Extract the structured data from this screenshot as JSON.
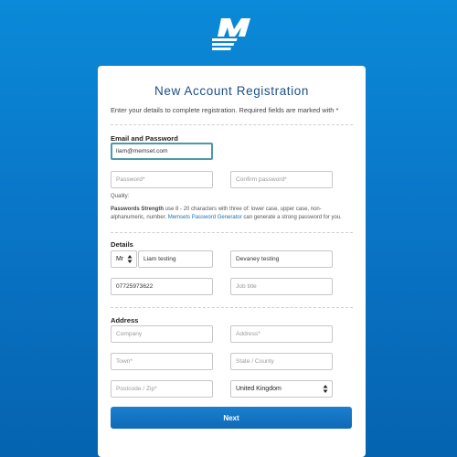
{
  "brand": {
    "logo_icon": "mythic-beasts-m-logo-icon",
    "accent": "#0a7fd4"
  },
  "form": {
    "title": "New Account Registration",
    "intro": "Enter your details to complete registration. Required fields are marked with *",
    "sections": {
      "email_password": "Email and Password",
      "details": "Details",
      "address": "Address"
    },
    "email": {
      "value": "liam@memset.com",
      "placeholder": ""
    },
    "password": {
      "placeholder": "Password*"
    },
    "confirm_password": {
      "placeholder": "Confirm password*"
    },
    "quality_label": "Quality:",
    "password_strength": {
      "label": "Passwords Strength",
      "text_before": " use 8 - 20 characters with three of: lower case, upper case, non-alphanumeric, number. ",
      "link": "Memsets Password Generator",
      "text_after": " can generate a strong password for you."
    },
    "title_select": {
      "value": "Mr"
    },
    "first_name": {
      "value": "Liam testing"
    },
    "last_name": {
      "value": "Devaney testing"
    },
    "phone": {
      "value": "07725973622"
    },
    "job_title": {
      "placeholder": "Job title"
    },
    "company": {
      "placeholder": "Company"
    },
    "address": {
      "placeholder": "Address*"
    },
    "town": {
      "placeholder": "Town*"
    },
    "state_county": {
      "placeholder": "State / County"
    },
    "postcode": {
      "placeholder": "Postcode / Zip*"
    },
    "country_select": {
      "value": "United Kingdom"
    },
    "next_button": "Next"
  }
}
